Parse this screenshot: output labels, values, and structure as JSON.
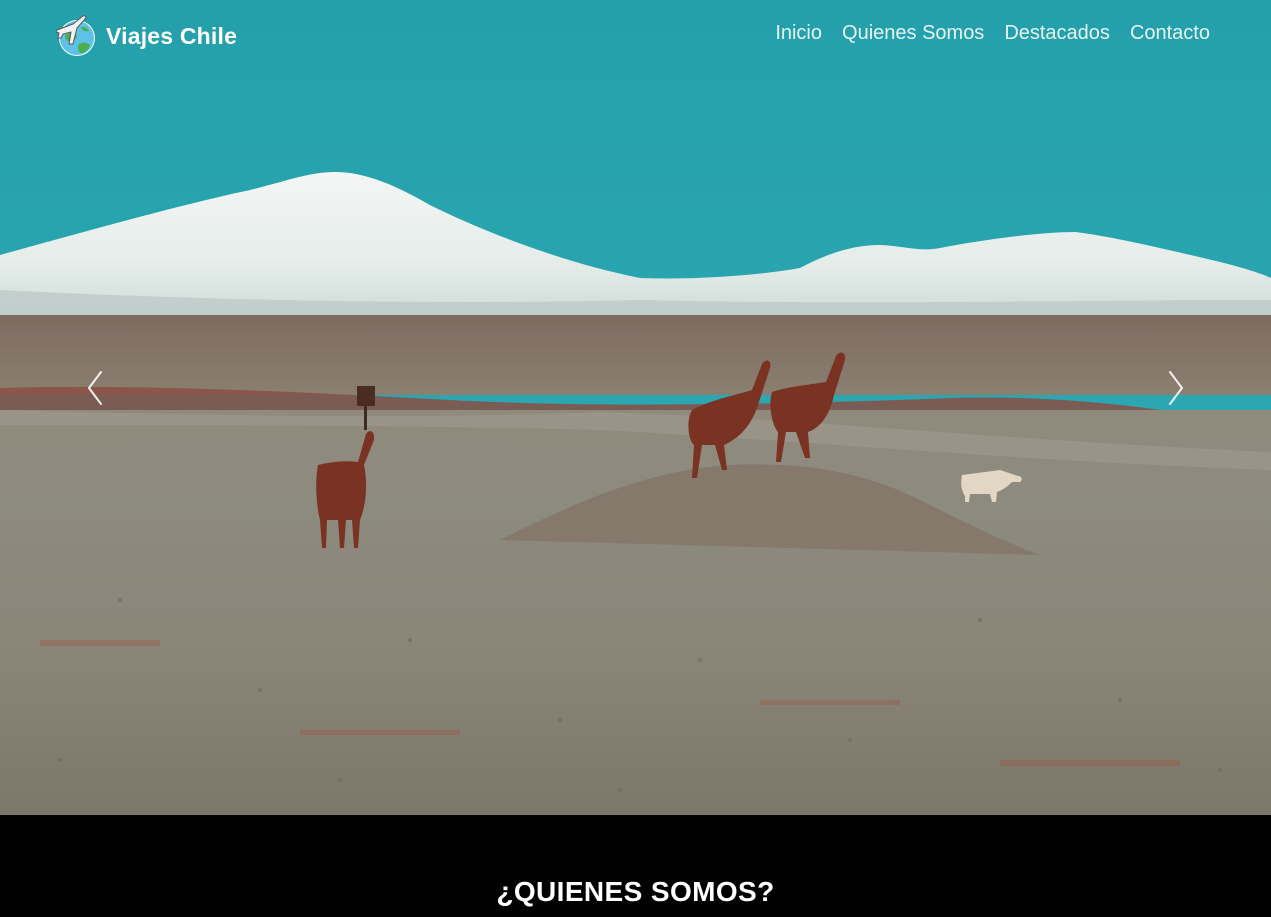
{
  "brand": {
    "name": "Viajes Chile",
    "logo_icon": "globe-airplane-icon"
  },
  "nav": {
    "items": [
      {
        "label": "Inicio"
      },
      {
        "label": "Quienes Somos"
      },
      {
        "label": "Destacados"
      },
      {
        "label": "Contacto"
      }
    ]
  },
  "carousel": {
    "prev_icon": "chevron-left-icon",
    "next_icon": "chevron-right-icon"
  },
  "about": {
    "title": "¿QUIENES SOMOS?"
  },
  "colors": {
    "sky": "#2aa6b0",
    "nav_text": "#e6f4f5",
    "section_bg": "#000000"
  }
}
